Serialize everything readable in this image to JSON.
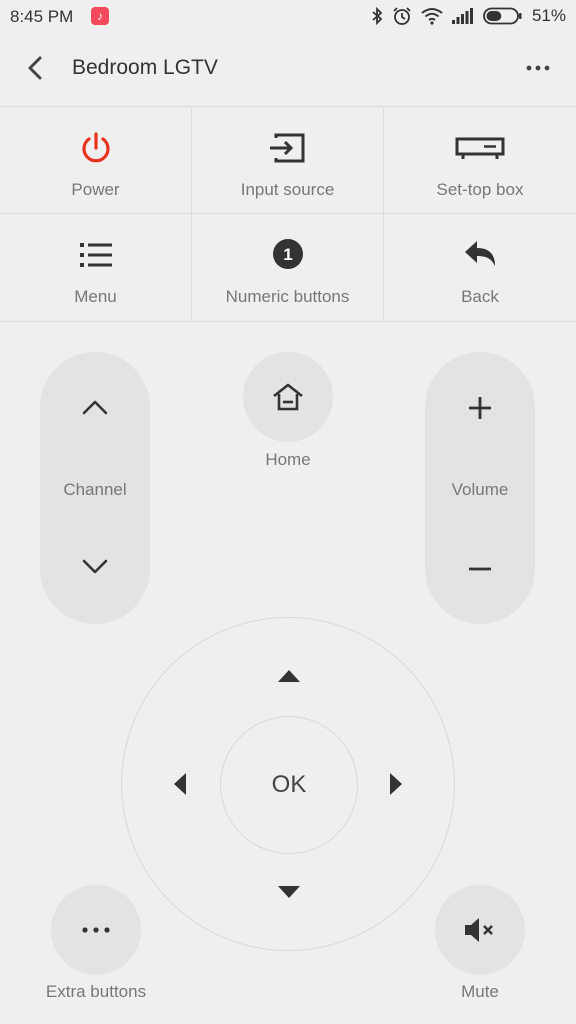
{
  "status_bar": {
    "time": "8:45 PM",
    "battery_percent": "51%",
    "battery_level": 0.51,
    "icons": [
      "music-app-icon",
      "bluetooth-icon",
      "alarm-icon",
      "wifi-icon",
      "signal-icon",
      "battery-icon"
    ]
  },
  "app_bar": {
    "title": "Bedroom LGTV"
  },
  "grid": {
    "power": {
      "label": "Power",
      "icon": "power-icon",
      "color": "#e8321e"
    },
    "input_source": {
      "label": "Input source",
      "icon": "input-source-icon"
    },
    "set_top_box": {
      "label": "Set-top box",
      "icon": "set-top-box-icon"
    },
    "menu": {
      "label": "Menu",
      "icon": "menu-list-icon"
    },
    "numeric": {
      "label": "Numeric buttons",
      "icon": "number-one-icon",
      "glyph": "1"
    },
    "back": {
      "label": "Back",
      "icon": "back-arrow-icon"
    }
  },
  "controls": {
    "channel_label": "Channel",
    "home_label": "Home",
    "volume_label": "Volume",
    "ok_label": "OK",
    "extra_label": "Extra buttons",
    "mute_label": "Mute"
  },
  "colors": {
    "background": "#efefef",
    "button_bg": "#e3e3e3",
    "text_dark": "#333333",
    "text_label": "#777777",
    "accent_red": "#e8321e"
  }
}
